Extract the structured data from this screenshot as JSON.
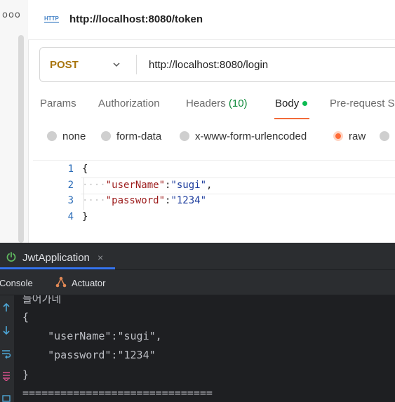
{
  "postman": {
    "rail": {
      "more_label": "ooo"
    },
    "request": {
      "icon_label": "HTTP",
      "title": "http://localhost:8080/token",
      "method": "POST",
      "url": "http://localhost:8080/login"
    },
    "tabs": [
      {
        "label": "Params"
      },
      {
        "label": "Authorization"
      },
      {
        "label": "Headers",
        "count": "(10)"
      },
      {
        "label": "Body"
      },
      {
        "label": "Pre-request S"
      }
    ],
    "body_types": [
      {
        "label": "none",
        "selected": false
      },
      {
        "label": "form-data",
        "selected": false
      },
      {
        "label": "x-www-form-urlencoded",
        "selected": false
      },
      {
        "label": "raw",
        "selected": true
      }
    ],
    "editor": {
      "line_numbers": [
        "1",
        "2",
        "3",
        "4"
      ],
      "lines": {
        "l1": "{",
        "l2_ws": "····",
        "l2_key": "\"userName\"",
        "l2_colon": ":",
        "l2_val": "\"sugi\"",
        "l2_end": ",",
        "l3_ws": "····",
        "l3_key": "\"password\"",
        "l3_colon": ":",
        "l3_val": "\"1234\"",
        "l4": "}"
      }
    },
    "colors": {
      "accent": "#ff6c37",
      "method": "#a8740c",
      "active_dot": "#0cbb52"
    }
  },
  "ide": {
    "run_tab": {
      "label": "JwtApplication",
      "close": "×"
    },
    "tool_tabs": [
      {
        "label": "Console"
      },
      {
        "label": "Actuator"
      }
    ],
    "console_lines": [
      "들어가네",
      "{",
      "    \"userName\":\"sugi\",",
      "    \"password\":\"1234\"",
      "}",
      "=============================="
    ],
    "colors": {
      "background": "#1e1f22",
      "panel": "#2b2d30",
      "text": "#bcbec4",
      "selection": "#3574f0"
    }
  }
}
